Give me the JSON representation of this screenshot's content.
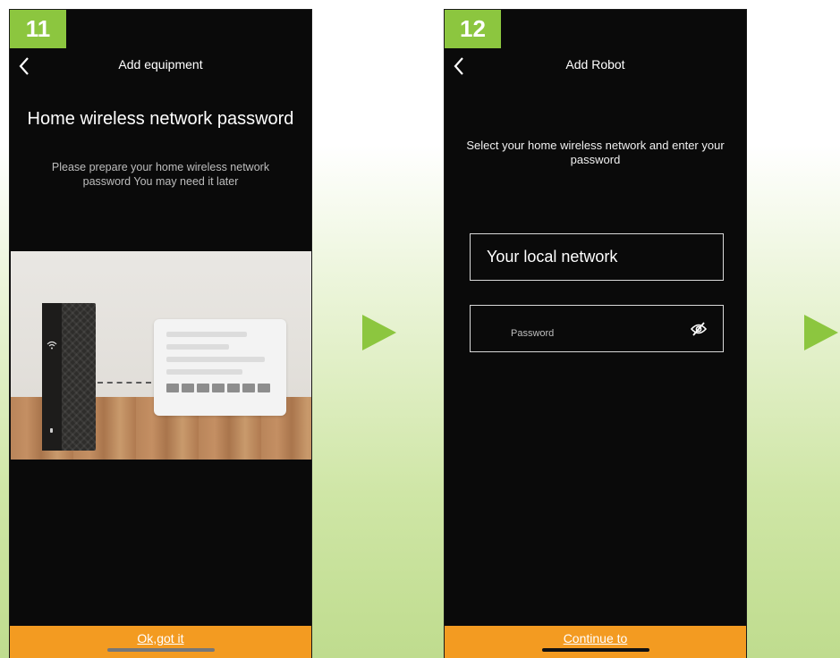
{
  "steps": [
    {
      "badge": "11",
      "nav_title": "Add equipment",
      "heading": "Home wireless network password",
      "subtext": "Please prepare your home wireless network password You may need it later",
      "button_label": "Ok,got it",
      "icons": {
        "back": "chevron-left-icon",
        "illustration": "router-illustration"
      }
    },
    {
      "badge": "12",
      "nav_title": "Add Robot",
      "subtext": "Select your home wireless network and enter your password",
      "network_value": "Your local network",
      "password_placeholder": "Password",
      "button_label": "Continue to",
      "icons": {
        "back": "chevron-left-icon",
        "visibility": "eye-off-icon"
      }
    }
  ],
  "colors": {
    "badge_green": "#8cc63f",
    "button_orange": "#f39b21",
    "arrow_green": "#8cc63f",
    "screen_bg": "#0a0a0a"
  }
}
